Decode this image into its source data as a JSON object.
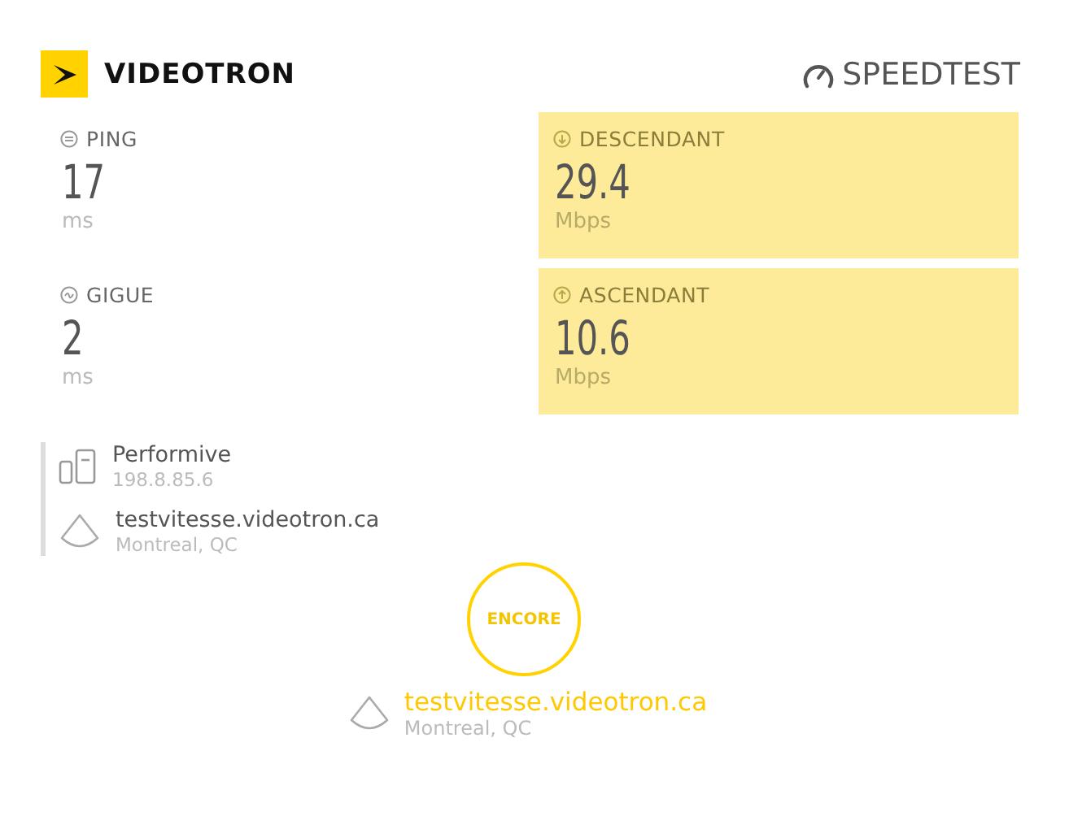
{
  "header": {
    "brand": "VIDEOTRON",
    "speedtest": "SPEEDTEST"
  },
  "metrics": [
    {
      "kind": "ping",
      "label": "PING",
      "value": "17",
      "unit": "ms",
      "highlighted": false
    },
    {
      "kind": "download",
      "label": "DESCENDANT",
      "value": "29.4",
      "unit": "Mbps",
      "highlighted": true
    },
    {
      "kind": "jitter",
      "label": "GIGUE",
      "value": "2",
      "unit": "ms",
      "highlighted": false
    },
    {
      "kind": "upload",
      "label": "ASCENDANT",
      "value": "10.6",
      "unit": "Mbps",
      "highlighted": true
    }
  ],
  "connection": [
    {
      "kind": "provider",
      "name": "Performive",
      "detail": "198.8.85.6"
    },
    {
      "kind": "server",
      "name": "testvitesse.videotron.ca",
      "detail": "Montreal, QC"
    }
  ],
  "go_button": "ENCORE",
  "selected_server": {
    "name": "testvitesse.videotron.ca",
    "location": "Montreal, QC"
  }
}
